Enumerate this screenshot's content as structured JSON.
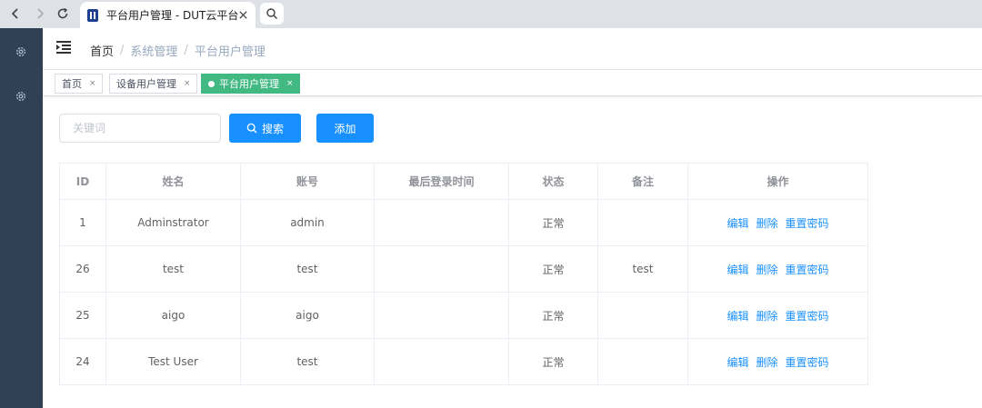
{
  "browser": {
    "tab_title": "平台用户管理 - DUT云平台",
    "icons": [
      "back-icon",
      "forward-icon",
      "reload-icon",
      "close-icon",
      "search-icon"
    ]
  },
  "sidebar": {
    "bg_color": "#304156",
    "icons": [
      "gear-icon",
      "gear-icon"
    ]
  },
  "header": {
    "breadcrumb": {
      "home": "首页",
      "separator": "/",
      "level1": "系统管理",
      "level2": "平台用户管理"
    }
  },
  "tags": {
    "items": [
      {
        "label": "首页",
        "close": "×",
        "active": false
      },
      {
        "label": "设备用户管理",
        "close": "×",
        "active": false
      },
      {
        "label": "平台用户管理",
        "close": "×",
        "active": true
      }
    ],
    "active_color": "#42b983"
  },
  "toolbar": {
    "search_placeholder": "关键词",
    "search_value": "",
    "search_button": "搜索",
    "add_button": "添加",
    "primary_color": "#1890ff"
  },
  "table": {
    "columns": [
      "ID",
      "姓名",
      "账号",
      "最后登录时间",
      "状态",
      "备注",
      "操作"
    ],
    "rows": [
      {
        "id": "1",
        "name": "Adminstrator",
        "account": "admin",
        "last_login": "",
        "status": "正常",
        "remark": ""
      },
      {
        "id": "26",
        "name": "test",
        "account": "test",
        "last_login": "",
        "status": "正常",
        "remark": "test"
      },
      {
        "id": "25",
        "name": "aigo",
        "account": "aigo",
        "last_login": "",
        "status": "正常",
        "remark": ""
      },
      {
        "id": "24",
        "name": "Test User",
        "account": "test",
        "last_login": "",
        "status": "正常",
        "remark": ""
      }
    ],
    "actions": {
      "edit": "编辑",
      "delete": "删除",
      "reset_password": "重置密码"
    },
    "link_color": "#1890ff"
  }
}
